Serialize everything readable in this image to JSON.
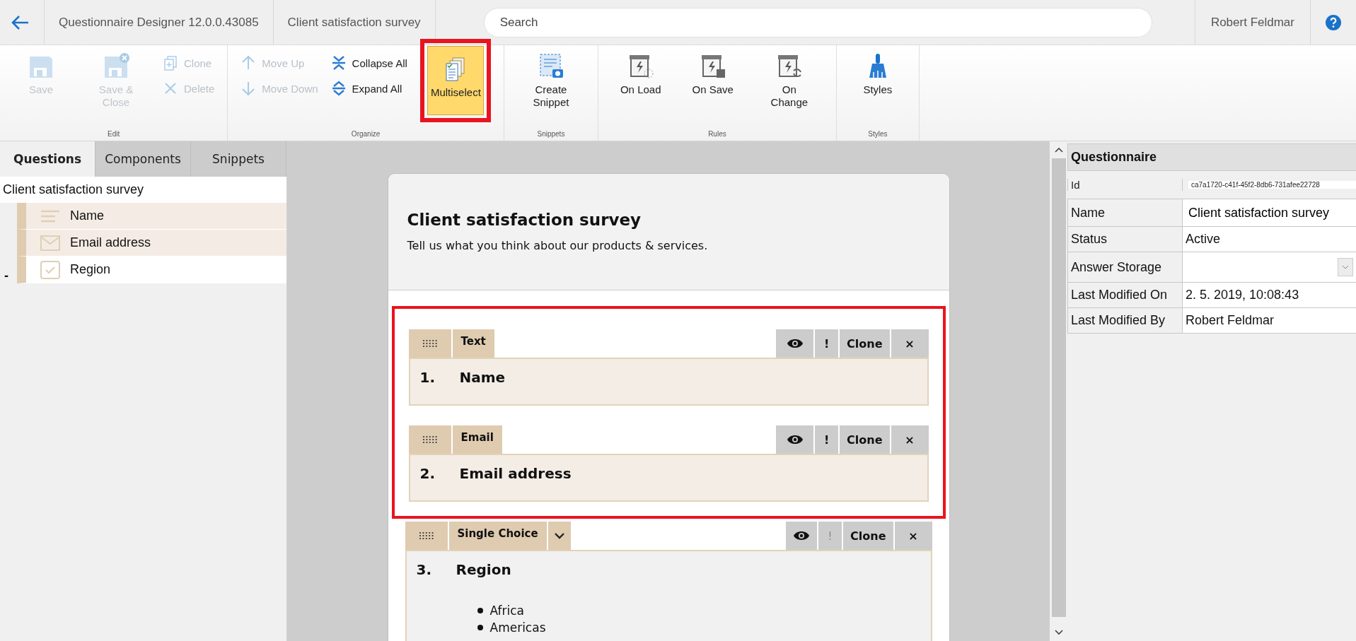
{
  "topbar": {
    "app_title": "Questionnaire Designer 12.0.0.43085",
    "document_title": "Client satisfaction survey",
    "search": {
      "placeholder": "Search"
    },
    "user": "Robert Feldmar"
  },
  "ribbon": {
    "groups": [
      {
        "label": "Edit",
        "columns": [
          {
            "kind": "large",
            "buttons": [
              {
                "kind": "save",
                "label": "Save",
                "disabled": true,
                "selected": false
              }
            ]
          },
          {
            "kind": "large",
            "buttons": [
              {
                "kind": "save-close",
                "label": "Save & Close",
                "disabled": true,
                "selected": false
              }
            ]
          },
          {
            "kind": "stack",
            "buttons": [
              {
                "kind": "clone",
                "label": "Clone",
                "disabled": true
              },
              {
                "kind": "delete",
                "label": "Delete",
                "disabled": true
              }
            ]
          }
        ]
      },
      {
        "label": "Organize",
        "columns": [
          {
            "kind": "stack",
            "buttons": [
              {
                "kind": "move-up",
                "label": "Move Up",
                "disabled": true
              },
              {
                "kind": "move-down",
                "label": "Move Down",
                "disabled": true
              }
            ]
          },
          {
            "kind": "stack",
            "buttons": [
              {
                "kind": "collapse",
                "label": "Collapse All",
                "disabled": false
              },
              {
                "kind": "expand",
                "label": "Expand All",
                "disabled": false
              }
            ]
          },
          {
            "kind": "large",
            "buttons": [
              {
                "kind": "multiselect",
                "label": "Multiselect",
                "disabled": false,
                "selected": true
              }
            ]
          }
        ]
      },
      {
        "label": "Snippets",
        "columns": [
          {
            "kind": "large",
            "buttons": [
              {
                "kind": "snippet",
                "label": "Create Snippet",
                "disabled": false,
                "selected": false
              }
            ]
          }
        ]
      },
      {
        "label": "Rules",
        "columns": [
          {
            "kind": "large",
            "buttons": [
              {
                "kind": "rule-load",
                "label": "On Load",
                "disabled": false,
                "selected": false
              }
            ]
          },
          {
            "kind": "large",
            "buttons": [
              {
                "kind": "rule-save",
                "label": "On Save",
                "disabled": false,
                "selected": false
              }
            ]
          },
          {
            "kind": "large",
            "buttons": [
              {
                "kind": "rule-change",
                "label": "On Change",
                "disabled": false,
                "selected": false
              }
            ]
          }
        ]
      },
      {
        "label": "Styles",
        "columns": [
          {
            "kind": "large",
            "buttons": [
              {
                "kind": "styles",
                "label": "Styles",
                "disabled": false,
                "selected": false
              }
            ]
          }
        ]
      }
    ]
  },
  "sidebar": {
    "tabs": [
      {
        "label": "Questions",
        "selected": true
      },
      {
        "label": "Components",
        "selected": false
      },
      {
        "label": "Snippets",
        "selected": false
      }
    ],
    "tree": {
      "label": "Client satisfaction survey",
      "children": [
        {
          "label": "Name",
          "kind": "text",
          "selected": true
        },
        {
          "label": "Email address",
          "kind": "email",
          "selected": true
        },
        {
          "label": "Region",
          "kind": "choice",
          "selected": false,
          "toggle": "-"
        }
      ]
    }
  },
  "survey": {
    "title": "Client satisfaction survey",
    "subtitle": "Tell us what you think about our products & services.",
    "questions": [
      {
        "number": "1.",
        "title": "Name",
        "type": "Text",
        "type_menu": false,
        "selected": true,
        "actions": [
          {
            "kind": "eye",
            "disabled": false
          },
          {
            "kind": "text",
            "label": "!",
            "disabled": false
          },
          {
            "kind": "text",
            "label": "Clone",
            "disabled": false
          },
          {
            "kind": "text",
            "label": "×",
            "disabled": false
          }
        ]
      },
      {
        "number": "2.",
        "title": "Email address",
        "type": "Email",
        "type_menu": false,
        "selected": true,
        "actions": [
          {
            "kind": "eye",
            "disabled": false
          },
          {
            "kind": "text",
            "label": "!",
            "disabled": false
          },
          {
            "kind": "text",
            "label": "Clone",
            "disabled": false
          },
          {
            "kind": "text",
            "label": "×",
            "disabled": false
          }
        ]
      },
      {
        "number": "3.",
        "title": "Region",
        "type": "Single Choice",
        "type_menu": true,
        "selected": false,
        "actions": [
          {
            "kind": "eye",
            "disabled": false
          },
          {
            "kind": "text",
            "label": "!",
            "disabled": true
          },
          {
            "kind": "text",
            "label": "Clone",
            "disabled": false
          },
          {
            "kind": "text",
            "label": "×",
            "disabled": false
          }
        ],
        "options": [
          "Africa",
          "Americas"
        ]
      }
    ]
  },
  "properties": {
    "title": "Questionnaire",
    "rows": [
      {
        "label": "Id",
        "value": "ca7a1720-c41f-45f2-8db6-731afee22728",
        "kind": "small"
      },
      {
        "label": "Name",
        "value": "Client satisfaction survey",
        "kind": "field"
      },
      {
        "label": "Status",
        "value": "Active",
        "kind": "text"
      },
      {
        "label": "Answer Storage",
        "kind": "select"
      },
      {
        "label": "Last Modified On",
        "value": "2. 5. 2019, 10:08:43",
        "kind": "text"
      },
      {
        "label": "Last Modified By",
        "value": "Robert Feldmar",
        "kind": "text"
      }
    ]
  }
}
